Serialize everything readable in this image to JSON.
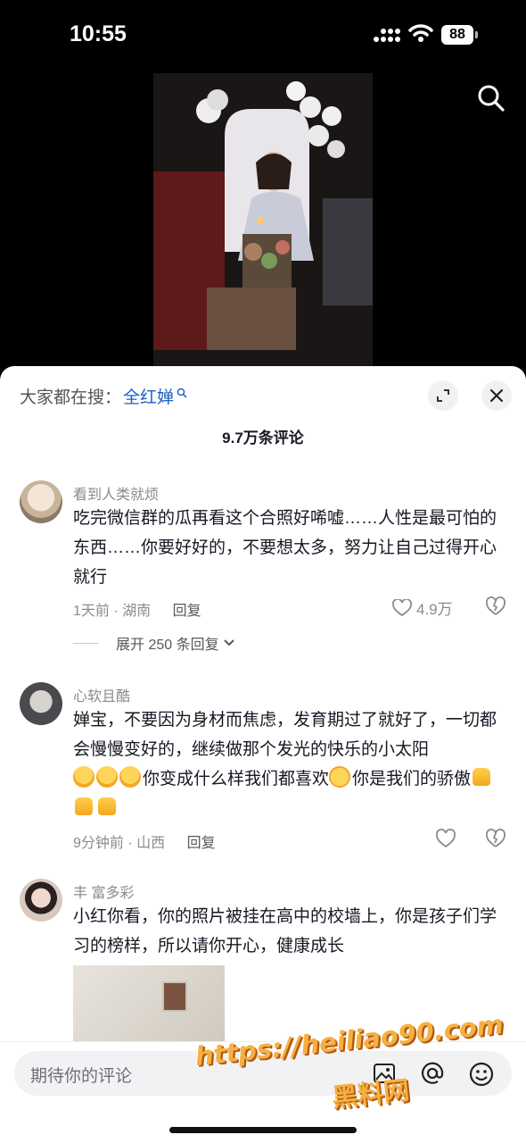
{
  "status_bar": {
    "time": "10:55",
    "battery": "88"
  },
  "icons": {
    "signal": "cellular-signal-icon",
    "wifi": "wifi-icon",
    "search": "search-icon",
    "expand": "expand-icon",
    "close": "close-icon",
    "heart": "heart-icon",
    "dislike": "broken-heart-icon",
    "image": "image-icon",
    "at": "at-icon",
    "emoji": "smiley-icon"
  },
  "sheet": {
    "trend_prefix": "大家都在搜：",
    "trend_keyword": "全红婵",
    "comment_count": "9.7万条评论"
  },
  "comments": [
    {
      "user": "看到人类就烦",
      "text": "吃完微信群的瓜再看这个合照好唏嘘……人性是最可怕的东西……你要好好的，不要想太多，努力让自己过得开心就行",
      "meta": "1天前 · 湖南",
      "reply": "回复",
      "likes": "4.9万",
      "expand": "展开 250 条回复"
    },
    {
      "user": "心软且酷",
      "text_a": "婵宝，不要因为身材而焦虑，发育期过了就好了，一切都会慢慢变好的，继续做那个发光的快乐的小太阳",
      "text_b": "你变成什么样我们都喜欢",
      "text_c": "你是我们的骄傲",
      "meta": "9分钟前 · 山西",
      "reply": "回复"
    },
    {
      "user": "丰  富多彩",
      "text": "小红你看，你的照片被挂在高中的校墙上，你是孩子们学习的榜样，所以请你开心，健康成长"
    }
  ],
  "input": {
    "placeholder": "期待你的评论"
  },
  "watermark": {
    "line1": "https://heiliao90.com",
    "line2": "黑料网"
  },
  "colors": {
    "link": "#1e5fc6",
    "watermark": "#f5b042"
  }
}
